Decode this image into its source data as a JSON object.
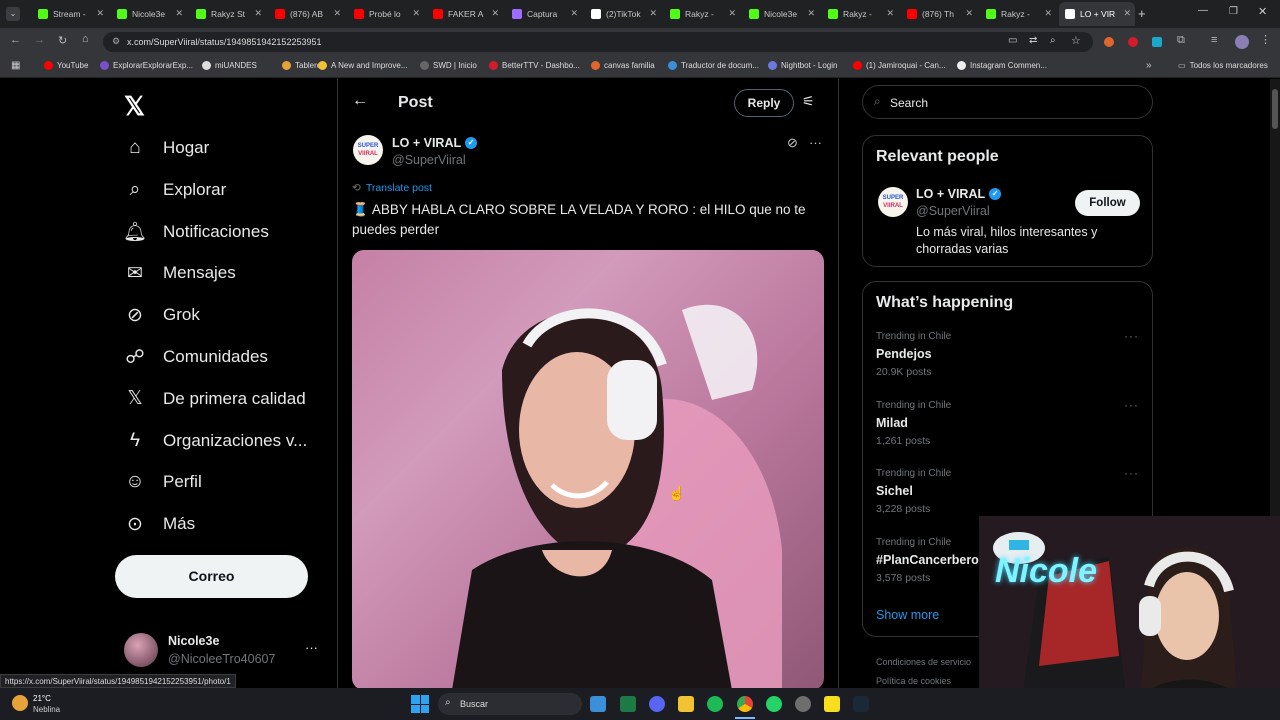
{
  "browser": {
    "tabs": [
      {
        "label": "Stream -",
        "color": "#53fc18"
      },
      {
        "label": "Nicole3e",
        "color": "#53fc18"
      },
      {
        "label": "Rakyz St",
        "color": "#53fc18"
      },
      {
        "label": "(876) AB",
        "color": "#ff0000"
      },
      {
        "label": "Probé lo",
        "color": "#ff0000"
      },
      {
        "label": "FAKER A",
        "color": "#ff0000"
      },
      {
        "label": "Captura",
        "color": "#9b6cff"
      },
      {
        "label": "(2)TikTok",
        "color": "#ffffff"
      },
      {
        "label": "Rakyz -",
        "color": "#53fc18"
      },
      {
        "label": "Nicole3e",
        "color": "#53fc18"
      },
      {
        "label": "Rakyz -",
        "color": "#53fc18"
      },
      {
        "label": "(876) Th",
        "color": "#ff0000"
      },
      {
        "label": "Rakyz -",
        "color": "#53fc18"
      },
      {
        "label": "LO + VIR",
        "color": "#ffffff"
      }
    ],
    "url": "x.com/SuperViiral/status/1949851942152253951",
    "bookmarks": [
      "YouTube",
      "ExplorarExplorarExp...",
      "miUANDES",
      "Tablero",
      "A New and Improve...",
      "SWD | Inicio",
      "BetterTTV - Dashbo...",
      "canvas familia",
      "Traductor de docum...",
      "Nightbot - Login",
      "(1) Jamiroquai - Can...",
      "Instagram Commen..."
    ],
    "bookmarks_all": "Todos los marcadores",
    "status_url": "https://x.com/SuperViiral/status/1949851942152253951/photo/1"
  },
  "sidebar": {
    "items": [
      {
        "label": "Hogar",
        "icon": "home-icon"
      },
      {
        "label": "Explorar",
        "icon": "search-icon"
      },
      {
        "label": "Notificaciones",
        "icon": "bell-icon"
      },
      {
        "label": "Mensajes",
        "icon": "mail-icon"
      },
      {
        "label": "Grok",
        "icon": "grok-icon"
      },
      {
        "label": "Comunidades",
        "icon": "people-icon"
      },
      {
        "label": "De primera calidad",
        "icon": "x-logo-icon"
      },
      {
        "label": "Organizaciones v...",
        "icon": "bolt-icon"
      },
      {
        "label": "Perfil",
        "icon": "person-icon"
      },
      {
        "label": "Más",
        "icon": "more-icon"
      }
    ],
    "cta": "Correo",
    "account": {
      "name": "Nicole3e",
      "handle": "@NicoleeTro40607"
    }
  },
  "post": {
    "header": "Post",
    "reply": "Reply",
    "author": {
      "name": "LO + VIRAL",
      "handle": "@SuperViiral",
      "avatar_text_1": "SUPER",
      "avatar_text_2": "VIIRAL"
    },
    "translate": "Translate post",
    "text": "🧵 ABBY HABLA CLARO SOBRE LA VELADA Y RORO : el HILO que no te puedes perder"
  },
  "right": {
    "search_placeholder": "Search",
    "relevant_title": "Relevant people",
    "person": {
      "name": "LO + VIRAL",
      "handle": "@SuperViiral",
      "bio": "Lo más viral, hilos interesantes y chorradas varias",
      "follow": "Follow"
    },
    "happening_title": "What’s happening",
    "trends": [
      {
        "context": "Trending in Chile",
        "name": "Pendejos",
        "posts": "20.9K posts"
      },
      {
        "context": "Trending in Chile",
        "name": "Milad",
        "posts": "1,261 posts"
      },
      {
        "context": "Trending in Chile",
        "name": "Sichel",
        "posts": "3,228 posts"
      },
      {
        "context": "Trending in Chile",
        "name": "#PlanCancerbero",
        "posts": "3,578 posts"
      }
    ],
    "show_more": "Show more",
    "footer": [
      "Condiciones de servicio",
      "Política de cookies"
    ]
  },
  "taskbar": {
    "weather_temp": "21°C",
    "weather_desc": "Neblina",
    "search": "Buscar"
  },
  "overlay": {
    "neon_text": "Nicole"
  }
}
